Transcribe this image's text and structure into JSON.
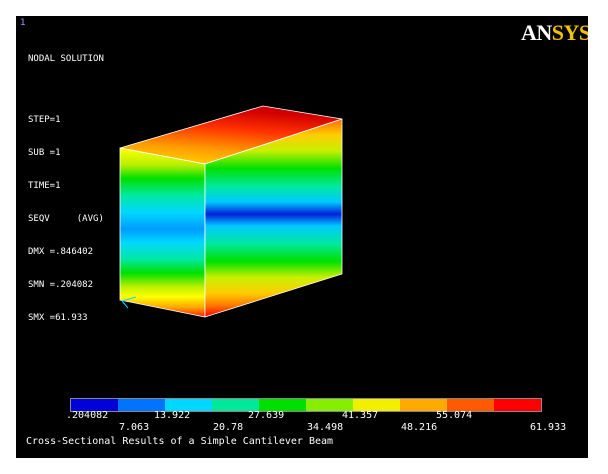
{
  "window_number": "1",
  "logo": {
    "an": "AN",
    "sys": "SYS"
  },
  "info": {
    "title": "NODAL SOLUTION",
    "step": "STEP=1",
    "sub": "SUB =1",
    "time": "TIME=1",
    "seqv": "SEQV     (AVG)",
    "dmx": "DMX =.846402",
    "smn": "SMN =.204082",
    "smx": "SMX =61.933"
  },
  "legend": {
    "colors": [
      "#0000d8",
      "#0074ff",
      "#00d8ff",
      "#00e89a",
      "#00e000",
      "#86ee00",
      "#f0f000",
      "#ffaa00",
      "#ff5a00",
      "#ff0000"
    ],
    "labels_top": [
      ".204082",
      "13.922",
      "27.639",
      "41.357",
      "55.074"
    ],
    "labels_bottom": [
      "7.063",
      "20.78",
      "34.498",
      "48.216",
      "61.933"
    ]
  },
  "caption": "Cross-Sectional Results of a Simple Cantilever Beam"
}
